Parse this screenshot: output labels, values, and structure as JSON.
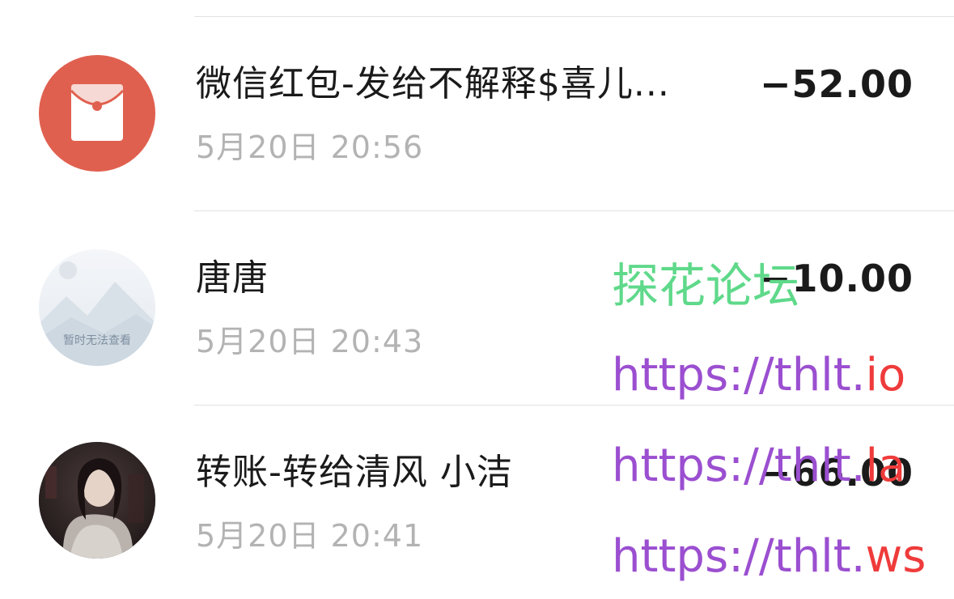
{
  "transactions": [
    {
      "title": "微信红包-发给不解释$喜儿...",
      "time": "5月20日 20:56",
      "amount": "−52.00",
      "avatar_icon": "red-envelope-icon",
      "avatar_color": "#e0604f"
    },
    {
      "title": "唐唐",
      "time": "5月20日 20:43",
      "amount": "−10.00",
      "avatar_icon": "image-unavailable-icon",
      "avatar_caption": "暂时无法查看"
    },
    {
      "title": "转账-转给清风 小洁",
      "time": "5月20日 20:41",
      "amount": "−66.00",
      "avatar_icon": "user-photo-avatar"
    }
  ],
  "watermark": {
    "forum": "探花论坛",
    "urls": [
      {
        "prefix": "https://thlt.",
        "tld": "io"
      },
      {
        "prefix": "https://thlt.",
        "tld": "la"
      },
      {
        "prefix": "https://thlt.",
        "tld": "ws"
      }
    ],
    "forum_color": "#5fd98a",
    "url_color": "#9b4fd0",
    "tld_color": "#ef3b3b"
  }
}
